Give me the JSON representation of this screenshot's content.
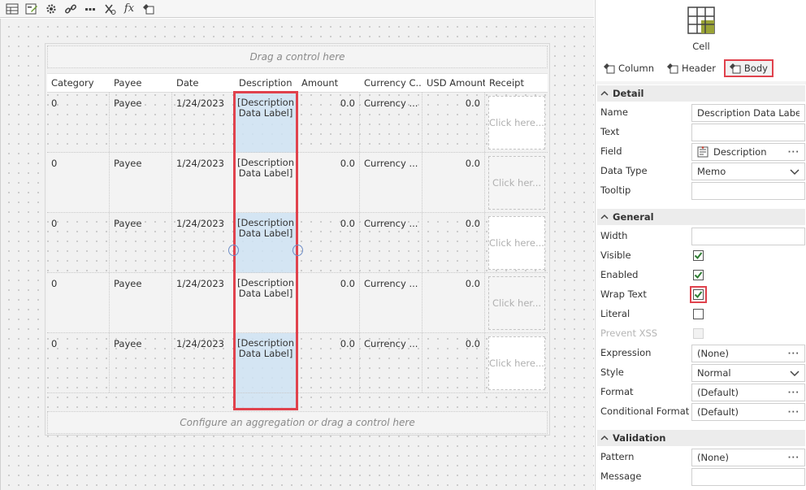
{
  "toolbar": {
    "buttons": [
      {
        "name": "table-grid-icon"
      },
      {
        "name": "edit-form-icon"
      },
      {
        "name": "gear-icon"
      },
      {
        "name": "link-icon"
      },
      {
        "name": "ellipsis-icon"
      },
      {
        "name": "function-variable-icon"
      },
      {
        "name": "expression-fx-icon"
      },
      {
        "name": "style-brush-icon"
      }
    ],
    "fx_label": "fx"
  },
  "canvas": {
    "drop_top": "Drag a control here",
    "drop_bottom": "Configure an aggregation or drag a control here",
    "columns": [
      "Category",
      "Payee",
      "Date",
      "Description",
      "Amount",
      "Currency C...",
      "USD Amount",
      "Receipt"
    ],
    "rows": [
      {
        "category": "0",
        "payee": "Payee",
        "date": "1/24/2023",
        "description": "[Description Data Label]",
        "amount": "0.0",
        "currency": "Currency ...",
        "usd_amount": "0.0",
        "receipt": "Click here..."
      },
      {
        "category": "0",
        "payee": "Payee",
        "date": "1/24/2023",
        "description": "[Description Data Label]",
        "amount": "0.0",
        "currency": "Currency ...",
        "usd_amount": "0.0",
        "receipt": "Click her..."
      },
      {
        "category": "0",
        "payee": "Payee",
        "date": "1/24/2023",
        "description": "[Description Data Label]",
        "amount": "0.0",
        "currency": "Currency ...",
        "usd_amount": "0.0",
        "receipt": "Click here..."
      },
      {
        "category": "0",
        "payee": "Payee",
        "date": "1/24/2023",
        "description": "[Description Data Label]",
        "amount": "0.0",
        "currency": "Currency ...",
        "usd_amount": "0.0",
        "receipt": "Click her..."
      },
      {
        "category": "0",
        "payee": "Payee",
        "date": "1/24/2023",
        "description": "[Description Data Label]",
        "amount": "0.0",
        "currency": "Currency ...",
        "usd_amount": "0.0",
        "receipt": "Click here..."
      }
    ]
  },
  "panel": {
    "title": "Cell",
    "tabs": [
      {
        "label": "Column",
        "active": false
      },
      {
        "label": "Header",
        "active": false
      },
      {
        "label": "Body",
        "active": true
      }
    ],
    "sections": {
      "detail": "Detail",
      "general": "General",
      "validation": "Validation"
    },
    "detail": {
      "name_label": "Name",
      "name_value": "Description Data Label",
      "text_label": "Text",
      "text_value": "",
      "field_label": "Field",
      "field_value": "Description",
      "datatype_label": "Data Type",
      "datatype_value": "Memo",
      "tooltip_label": "Tooltip",
      "tooltip_value": ""
    },
    "general": {
      "width_label": "Width",
      "width_value": "",
      "visible_label": "Visible",
      "visible": true,
      "enabled_label": "Enabled",
      "enabled": true,
      "wrap_label": "Wrap Text",
      "wrap": true,
      "literal_label": "Literal",
      "literal": false,
      "xss_label": "Prevent XSS",
      "xss": false,
      "expression_label": "Expression",
      "expression_value": "(None)",
      "style_label": "Style",
      "style_value": "Normal",
      "format_label": "Format",
      "format_value": "(Default)",
      "condformat_label": "Conditional Format",
      "condformat_value": "(Default)"
    },
    "validation": {
      "pattern_label": "Pattern",
      "pattern_value": "(None)",
      "message_label": "Message",
      "message_value": ""
    }
  },
  "colors": {
    "highlight": "#e0424d",
    "selection": "#cfe3f3",
    "check": "#2e7d32",
    "cell_icon_accent": "#9aa336"
  }
}
